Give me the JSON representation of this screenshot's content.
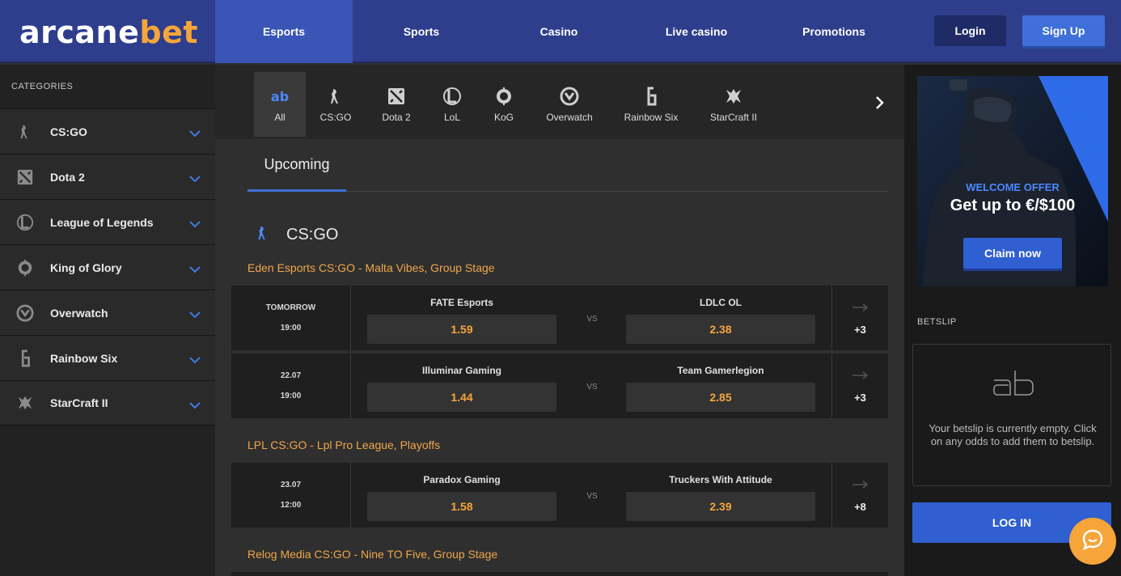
{
  "brand": {
    "part1": "arcane",
    "part2": "bet"
  },
  "nav": [
    {
      "label": "Esports",
      "active": true
    },
    {
      "label": "Sports"
    },
    {
      "label": "Casino"
    },
    {
      "label": "Live casino"
    },
    {
      "label": "Promotions"
    }
  ],
  "header": {
    "login": "Login",
    "signup": "Sign Up"
  },
  "sidebar": {
    "heading": "CATEGORIES",
    "items": [
      {
        "label": "CS:GO",
        "icon": "csgo-icon"
      },
      {
        "label": "Dota 2",
        "icon": "dota2-icon"
      },
      {
        "label": "League of Legends",
        "icon": "lol-icon"
      },
      {
        "label": "King of Glory",
        "icon": "kog-icon"
      },
      {
        "label": "Overwatch",
        "icon": "overwatch-icon"
      },
      {
        "label": "Rainbow Six",
        "icon": "rainbow-six-icon"
      },
      {
        "label": "StarCraft II",
        "icon": "starcraft-icon"
      }
    ]
  },
  "games": [
    {
      "label": "All",
      "icon": "ab-icon",
      "active": true
    },
    {
      "label": "CS:GO",
      "icon": "csgo-icon"
    },
    {
      "label": "Dota 2",
      "icon": "dota2-icon"
    },
    {
      "label": "LoL",
      "icon": "lol-icon"
    },
    {
      "label": "KoG",
      "icon": "kog-icon"
    },
    {
      "label": "Overwatch",
      "icon": "overwatch-icon"
    },
    {
      "label": "Rainbow Six",
      "icon": "rainbow-six-icon"
    },
    {
      "label": "StarCraft II",
      "icon": "starcraft-icon"
    }
  ],
  "tabs": {
    "upcoming": "Upcoming"
  },
  "section": {
    "title": "CS:GO"
  },
  "leagues": [
    {
      "name": "Eden Esports CS:GO - Malta Vibes, Group Stage",
      "matches": [
        {
          "date": "TOMORROW",
          "time": "19:00",
          "home": "FATE Esports",
          "away": "LDLC OL",
          "home_odd": "1.59",
          "away_odd": "2.38",
          "vs": "VS",
          "more": "+3"
        },
        {
          "date": "22.07",
          "time": "19:00",
          "home": "Illuminar Gaming",
          "away": "Team Gamerlegion",
          "home_odd": "1.44",
          "away_odd": "2.85",
          "vs": "VS",
          "more": "+3"
        }
      ]
    },
    {
      "name": "LPL CS:GO - Lpl Pro League, Playoffs",
      "matches": [
        {
          "date": "23.07",
          "time": "12:00",
          "home": "Paradox Gaming",
          "away": "Truckers With Attitude",
          "home_odd": "1.58",
          "away_odd": "2.39",
          "vs": "VS",
          "more": "+8"
        }
      ]
    },
    {
      "name": "Relog Media CS:GO - Nine TO Five, Group Stage",
      "matches": []
    }
  ],
  "promo": {
    "kicker": "WELCOME OFFER",
    "headline": "Get up to €/$100",
    "cta": "Claim now"
  },
  "betslip": {
    "heading": "BETSLIP",
    "empty_msg": "Your betslip is currently empty. Click on any odds to add them to betslip.",
    "login": "LOG IN"
  },
  "colors": {
    "brand_blue": "#2e3e8c",
    "accent_orange": "#f5a53a",
    "accent_blue": "#3e6fd6"
  }
}
